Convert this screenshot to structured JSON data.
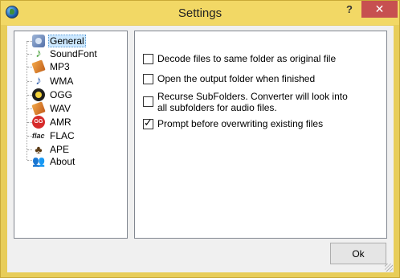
{
  "window": {
    "title": "Settings",
    "help_label": "?",
    "close_label": "✕"
  },
  "tree": {
    "items": [
      {
        "label": "General",
        "icon": "general-icon",
        "selected": true
      },
      {
        "label": "SoundFont",
        "icon": "soundfont-icon"
      },
      {
        "label": "MP3",
        "icon": "mp3-icon"
      },
      {
        "label": "WMA",
        "icon": "wma-icon"
      },
      {
        "label": "OGG",
        "icon": "ogg-icon"
      },
      {
        "label": "WAV",
        "icon": "wav-icon"
      },
      {
        "label": "AMR",
        "icon": "amr-icon"
      },
      {
        "label": "FLAC",
        "icon": "flac-icon"
      },
      {
        "label": "APE",
        "icon": "ape-icon"
      },
      {
        "label": "About",
        "icon": "about-icon"
      }
    ]
  },
  "icons": {
    "soundfont": "♪",
    "wma": "♪",
    "amr": "GG",
    "flac": "flac",
    "ape": "♣",
    "about": "👥"
  },
  "options": [
    {
      "label": "Decode files to same folder as original file",
      "checked": false
    },
    {
      "label": "Open the output folder when finished",
      "checked": false
    },
    {
      "label": "Recurse SubFolders. Converter will look into all subfolders for audio files.",
      "checked": false
    },
    {
      "label": "Prompt before overwriting existing files",
      "checked": true
    }
  ],
  "buttons": {
    "ok_label": "Ok"
  },
  "colors": {
    "titlebar": "#f2d865",
    "close": "#c75050",
    "selection": "#cce8ff"
  }
}
